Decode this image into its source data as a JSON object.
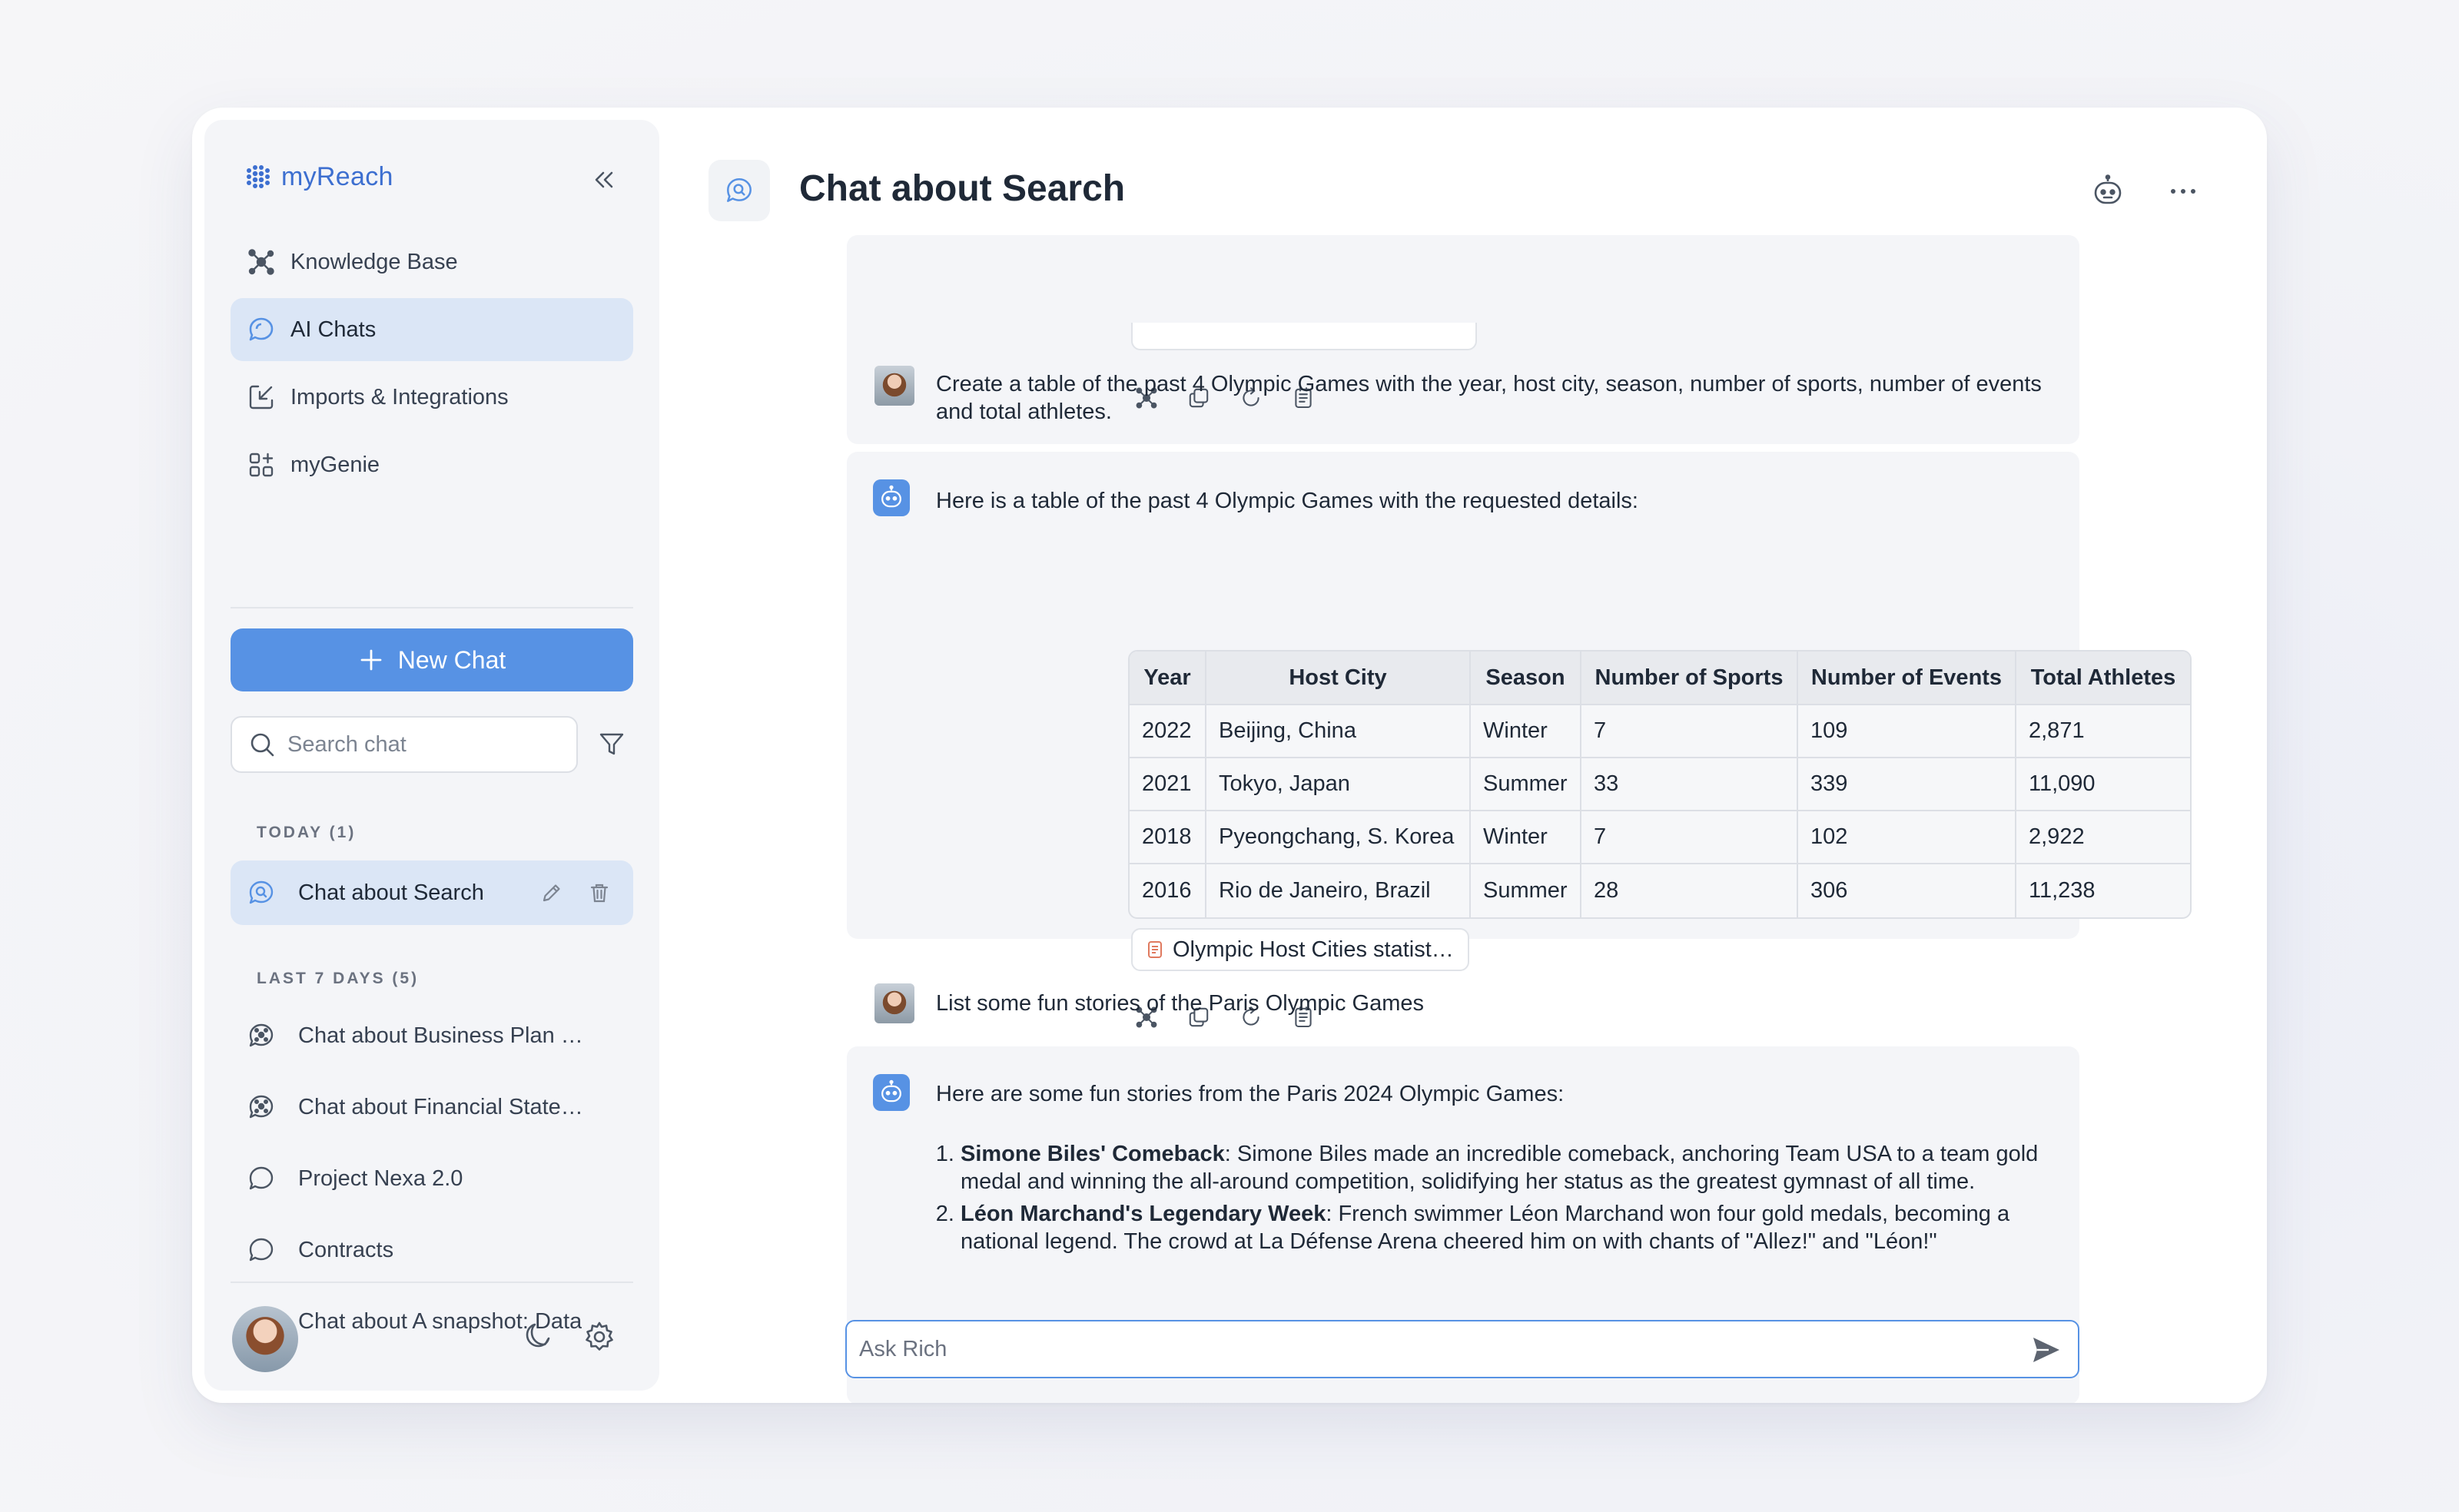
{
  "brand": {
    "name": "myReach"
  },
  "sidebar": {
    "nav": [
      {
        "label": "Knowledge Base",
        "icon": "network-icon"
      },
      {
        "label": "AI Chats",
        "icon": "chat-bubble-icon",
        "active": true
      },
      {
        "label": "Imports & Integrations",
        "icon": "import-icon"
      },
      {
        "label": "myGenie",
        "icon": "apps-grid-icon"
      }
    ],
    "new_chat_label": "New Chat",
    "search_placeholder": "Search chat",
    "today_label": "TODAY (1)",
    "today_items": [
      {
        "label": "Chat about Search",
        "active": true
      }
    ],
    "last7_label": "LAST 7 DAYS (5)",
    "last7_items": [
      {
        "label": "Chat about Business Plan Overview",
        "icon": "ai-chat-icon"
      },
      {
        "label": "Chat about Financial Statements",
        "icon": "ai-chat-icon"
      },
      {
        "label": "Project Nexa 2.0",
        "icon": "chat-icon"
      },
      {
        "label": "Contracts",
        "icon": "chat-icon"
      },
      {
        "label": "Chat about A snapshot: Data",
        "icon": "ai-chat-icon"
      }
    ]
  },
  "header": {
    "title": "Chat about Search"
  },
  "messages": {
    "user_1": "Create a table of the past 4 Olympic Games with the year, host city, season, number of sports, number of events and total athletes.",
    "bot_1_intro": "Here is a table of the past 4 Olympic Games with the requested details:",
    "table": {
      "headers": [
        "Year",
        "Host City",
        "Season",
        "Number of Sports",
        "Number of Events",
        "Total Athletes"
      ],
      "rows": [
        [
          "2022",
          "Beijing, China",
          "Winter",
          "7",
          "109",
          "2,871"
        ],
        [
          "2021",
          "Tokyo, Japan",
          "Summer",
          "33",
          "339",
          "11,090"
        ],
        [
          "2018",
          "Pyeongchang, S. Korea",
          "Winter",
          "7",
          "102",
          "2,922"
        ],
        [
          "2016",
          "Rio de Janeiro, Brazil",
          "Summer",
          "28",
          "306",
          "11,238"
        ]
      ]
    },
    "source_chip": "Olympic Host Cities statist…",
    "user_2": "List some fun stories of the Paris Olympic Games",
    "bot_2_intro": "Here are some fun stories from the Paris 2024 Olympic Games:",
    "stories": [
      {
        "title": "Simone Biles' Comeback",
        "text": ": Simone Biles made an incredible comeback, anchoring Team USA to a team gold medal and winning the all-around competition, solidifying her status as the greatest gymnast of all time."
      },
      {
        "title": "Léon Marchand's Legendary Week",
        "text": ": French swimmer Léon Marchand won four gold medals, becoming a national legend. The crowd at La Défense Arena cheered him on with chants of \"Allez!\" and \"Léon!\""
      }
    ]
  },
  "composer": {
    "placeholder": "Ask Rich"
  },
  "colors": {
    "accent": "#5792e4",
    "active_bg": "#dbe6f6",
    "sidebar_bg": "#f4f5f8",
    "brand": "#3d6fd0"
  }
}
